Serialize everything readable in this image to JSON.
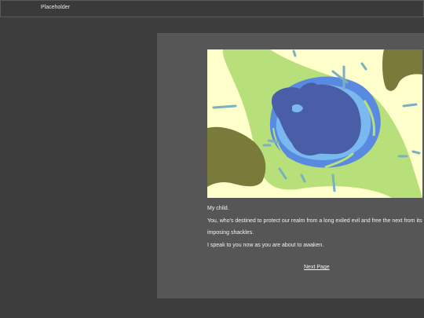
{
  "app": {
    "title": "Placeholder"
  },
  "story": {
    "lines": [
      "My child.",
      "You, who's destined to protect our realm from a long exiled evil and free the next from its",
      "imposing shackles.",
      "I speak to you now as you are about to awaken."
    ],
    "next_label": "Next Page"
  },
  "illustration": {
    "background_color": "#ffffcc",
    "leaf_color": "#b8e07a",
    "rock_color": "#7a7a3a",
    "eye_outer_color": "#5a8ae0",
    "eye_mid_color": "#7ab8f0",
    "eye_inner_color": "#4a5ea8",
    "ray_color": "#7ab0c0"
  }
}
